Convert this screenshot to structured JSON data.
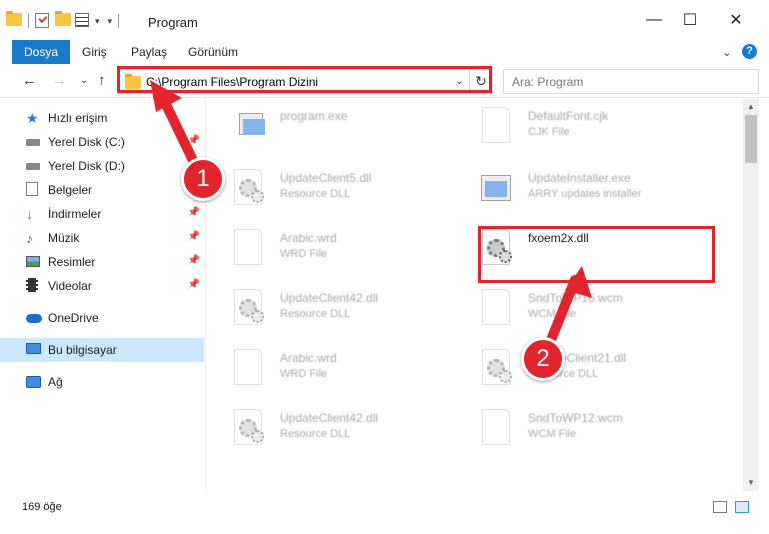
{
  "window": {
    "title": "Program",
    "controls": {
      "minimize": "—",
      "maximize": "☐",
      "close": "✕"
    }
  },
  "ribbon": {
    "tabs": [
      "Dosya",
      "Giriş",
      "Paylaş",
      "Görünüm"
    ],
    "active_tab": "Dosya",
    "expand": "⌄",
    "help": "?"
  },
  "nav": {
    "back": "←",
    "forward": "→",
    "recent": "⌄",
    "up": "↑",
    "address": "C:\\Program Files\\Program Dizini",
    "dropdown": "⌄",
    "refresh": "↻",
    "search_placeholder": "Ara: Program"
  },
  "sidebar": {
    "items": [
      {
        "label": "Hızlı erişim",
        "icon": "star-icon",
        "pinned": false,
        "selected": false
      },
      {
        "label": "Yerel Disk (C:)",
        "icon": "disk-icon",
        "pinned": true,
        "selected": false
      },
      {
        "label": "Yerel Disk (D:)",
        "icon": "disk-icon",
        "pinned": false,
        "selected": false
      },
      {
        "label": "Belgeler",
        "icon": "documents-icon",
        "pinned": true,
        "selected": false
      },
      {
        "label": "İndirmeler",
        "icon": "download-icon",
        "pinned": true,
        "selected": false
      },
      {
        "label": "Müzik",
        "icon": "music-icon",
        "pinned": true,
        "selected": false
      },
      {
        "label": "Resimler",
        "icon": "pictures-icon",
        "pinned": true,
        "selected": false
      },
      {
        "label": "Videolar",
        "icon": "videos-icon",
        "pinned": true,
        "selected": false
      },
      {
        "label": "OneDrive",
        "icon": "onedrive-icon",
        "pinned": false,
        "selected": false
      },
      {
        "label": "Bu bilgisayar",
        "icon": "this-pc-icon",
        "pinned": false,
        "selected": true
      },
      {
        "label": "Ağ",
        "icon": "network-icon",
        "pinned": false,
        "selected": false
      }
    ],
    "pin_glyph": "📌"
  },
  "files": [
    {
      "name": "program.exe",
      "type": "",
      "icon": "program-exe-icon",
      "faded": true
    },
    {
      "name": "DefaultFont.cjk",
      "type": "CJK File",
      "icon": "blank-file-icon",
      "faded": true
    },
    {
      "name": "UpdateClient5.dll",
      "type": "Resource DLL",
      "icon": "dll-gear-icon",
      "faded": true
    },
    {
      "name": "UpdateInstaller.exe",
      "type": "ARRY updates installer",
      "icon": "installer-exe-icon",
      "faded": true
    },
    {
      "name": "Arabic.wrd",
      "type": "WRD File",
      "icon": "blank-file-icon",
      "faded": true
    },
    {
      "name": "fxoem2x.dll",
      "type": "",
      "icon": "dll-gear-icon",
      "faded": false
    },
    {
      "name": "UpdateClient42.dll",
      "type": "Resource DLL",
      "icon": "dll-gear-icon",
      "faded": true
    },
    {
      "name": "SndToWP16.wcm",
      "type": "WCM File",
      "icon": "blank-file-icon",
      "faded": true
    },
    {
      "name": "Arabic.wrd",
      "type": "WRD File",
      "icon": "blank-file-icon",
      "faded": true
    },
    {
      "name": "UpdateClient21.dll",
      "type": "Resource DLL",
      "icon": "dll-gear-icon",
      "faded": true
    },
    {
      "name": "UpdateClient42.dll",
      "type": "Resource DLL",
      "icon": "dll-gear-icon",
      "faded": true
    },
    {
      "name": "SndToWP12.wcm",
      "type": "WCM File",
      "icon": "blank-file-icon",
      "faded": true
    }
  ],
  "status": {
    "item_count": "169 öğe"
  },
  "annotations": {
    "step1": "1",
    "step2": "2",
    "highlight_color": "#e2242c"
  },
  "colors": {
    "accent": "#1979ca",
    "selection": "#cce8ff",
    "annotation": "#e2242c"
  }
}
